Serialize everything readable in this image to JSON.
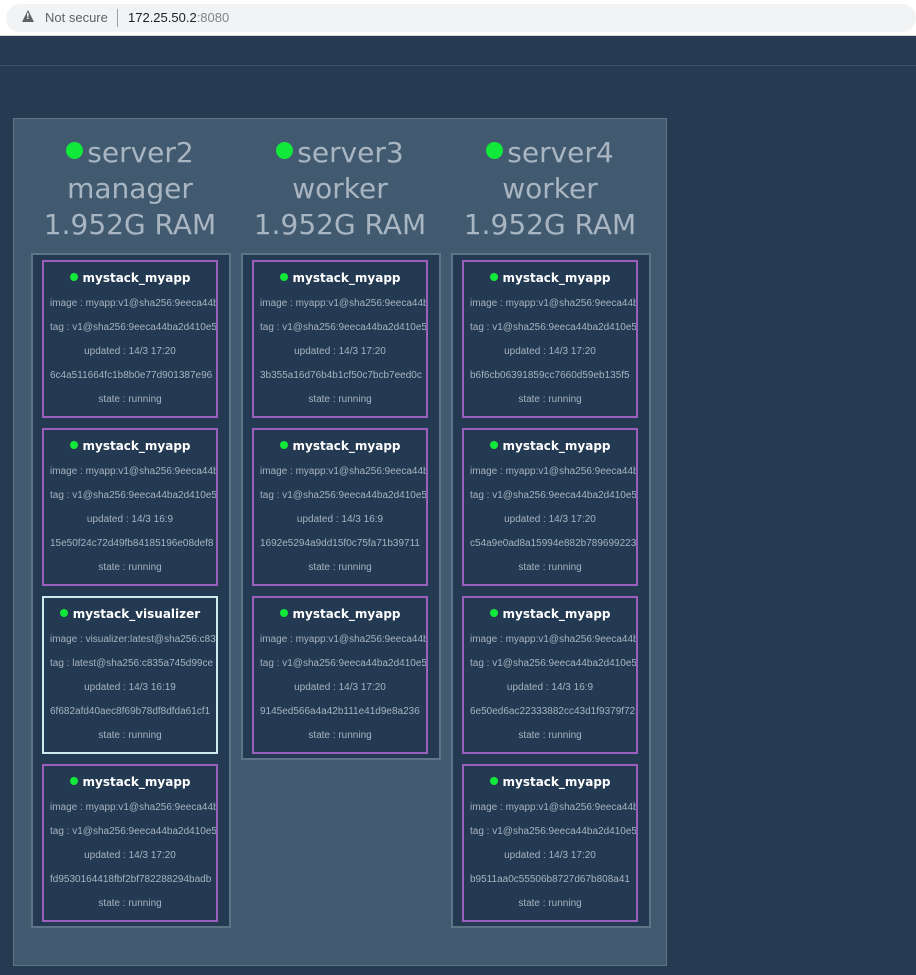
{
  "browser": {
    "security_label": "Not secure",
    "url_host": "172.25.50.2",
    "url_port": ":8080"
  },
  "nodes": [
    {
      "name": "server2",
      "role": "manager",
      "ram": "1.952G RAM",
      "tasks": [
        {
          "name": "mystack_myapp",
          "image": "image : myapp:v1@sha256:9eeca44b",
          "tag": "tag : v1@sha256:9eeca44ba2d410e5",
          "updated": "updated : 14/3 17:20",
          "id": "6c4a511664fc1b8b0e77d901387e96",
          "state": "state : running"
        },
        {
          "name": "mystack_myapp",
          "image": "image : myapp:v1@sha256:9eeca44b",
          "tag": "tag : v1@sha256:9eeca44ba2d410e5",
          "updated": "updated : 14/3 16:9",
          "id": "15e50f24c72d49fb84185196e08def8",
          "state": "state : running"
        },
        {
          "name": "mystack_visualizer",
          "image": "image : visualizer:latest@sha256:c83",
          "tag": "tag : latest@sha256:c835a745d99ce",
          "updated": "updated : 14/3 16:19",
          "id": "6f682afd40aec8f69b78df8dfda61cf1",
          "state": "state : running"
        },
        {
          "name": "mystack_myapp",
          "image": "image : myapp:v1@sha256:9eeca44b",
          "tag": "tag : v1@sha256:9eeca44ba2d410e5",
          "updated": "updated : 14/3 17:20",
          "id": "fd9530164418fbf2bf782288294badb",
          "state": "state : running"
        }
      ]
    },
    {
      "name": "server3",
      "role": "worker",
      "ram": "1.952G RAM",
      "tasks": [
        {
          "name": "mystack_myapp",
          "image": "image : myapp:v1@sha256:9eeca44b",
          "tag": "tag : v1@sha256:9eeca44ba2d410e5",
          "updated": "updated : 14/3 17:20",
          "id": "3b355a16d76b4b1cf50c7bcb7eed0c",
          "state": "state : running"
        },
        {
          "name": "mystack_myapp",
          "image": "image : myapp:v1@sha256:9eeca44b",
          "tag": "tag : v1@sha256:9eeca44ba2d410e5",
          "updated": "updated : 14/3 16:9",
          "id": "1692e5294a9dd15f0c75fa71b39711",
          "state": "state : running"
        },
        {
          "name": "mystack_myapp",
          "image": "image : myapp:v1@sha256:9eeca44b",
          "tag": "tag : v1@sha256:9eeca44ba2d410e5",
          "updated": "updated : 14/3 17:20",
          "id": "9145ed566a4a42b111e41d9e8a236",
          "state": "state : running"
        }
      ]
    },
    {
      "name": "server4",
      "role": "worker",
      "ram": "1.952G RAM",
      "tasks": [
        {
          "name": "mystack_myapp",
          "image": "image : myapp:v1@sha256:9eeca44b",
          "tag": "tag : v1@sha256:9eeca44ba2d410e5",
          "updated": "updated : 14/3 17:20",
          "id": "b6f6cb06391859cc7660d59eb135f5",
          "state": "state : running"
        },
        {
          "name": "mystack_myapp",
          "image": "image : myapp:v1@sha256:9eeca44b",
          "tag": "tag : v1@sha256:9eeca44ba2d410e5",
          "updated": "updated : 14/3 17:20",
          "id": "c54a9e0ad8a15994e882b789699223",
          "state": "state : running"
        },
        {
          "name": "mystack_myapp",
          "image": "image : myapp:v1@sha256:9eeca44b",
          "tag": "tag : v1@sha256:9eeca44ba2d410e5",
          "updated": "updated : 14/3 16:9",
          "id": "6e50ed6ac22333882cc43d1f9379f72",
          "state": "state : running"
        },
        {
          "name": "mystack_myapp",
          "image": "image : myapp:v1@sha256:9eeca44b",
          "tag": "tag : v1@sha256:9eeca44ba2d410e5",
          "updated": "updated : 14/3 17:20",
          "id": "b9511aa0c55506b8727d67b808a41",
          "state": "state : running"
        }
      ]
    }
  ],
  "colors": {
    "status_running": "#11e93a",
    "app_task_border": "#9b5fbd",
    "visualizer_task_border": "#cde9ec"
  }
}
